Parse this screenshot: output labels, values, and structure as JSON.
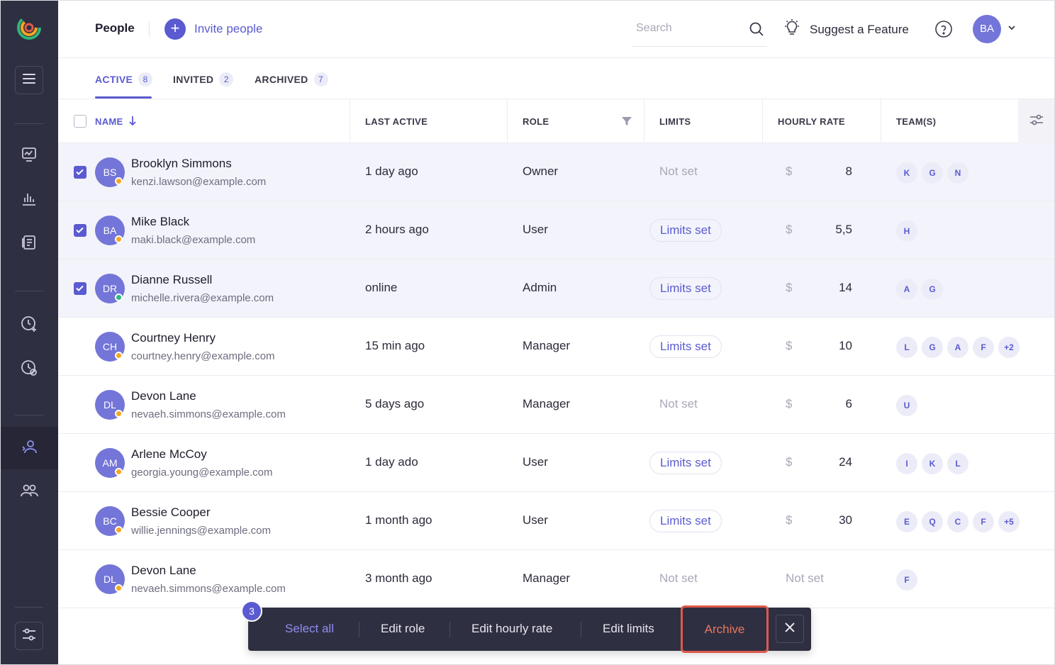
{
  "header": {
    "title": "People",
    "invite_label": "Invite people",
    "search_placeholder": "Search",
    "suggest_label": "Suggest a Feature",
    "user_initials": "BA"
  },
  "tabs": [
    {
      "label": "ACTIVE",
      "count": "8",
      "active": true
    },
    {
      "label": "INVITED",
      "count": "2",
      "active": false
    },
    {
      "label": "ARCHIVED",
      "count": "7",
      "active": false
    }
  ],
  "columns": {
    "name": "NAME",
    "last_active": "LAST ACTIVE",
    "role": "ROLE",
    "limits": "LIMITS",
    "hourly_rate": "HOURLY RATE",
    "teams": "TEAM(S)"
  },
  "rows": [
    {
      "initials": "BS",
      "name": "Brooklyn Simmons",
      "email": "kenzi.lawson@example.com",
      "status": "away",
      "last_active": "1 day ago",
      "role": "Owner",
      "limits": "Not set",
      "limits_set": false,
      "currency": "$",
      "rate": "8",
      "teams": [
        "K",
        "G",
        "N"
      ],
      "selected": true
    },
    {
      "initials": "BA",
      "name": "Mike Black",
      "email": "maki.black@example.com",
      "status": "away",
      "last_active": "2 hours ago",
      "role": "User",
      "limits": "Limits set",
      "limits_set": true,
      "currency": "$",
      "rate": "5,5",
      "teams": [
        "H"
      ],
      "selected": true
    },
    {
      "initials": "DR",
      "name": "Dianne Russell",
      "email": "michelle.rivera@example.com",
      "status": "online",
      "last_active": "online",
      "role": "Admin",
      "limits": "Limits set",
      "limits_set": true,
      "currency": "$",
      "rate": "14",
      "teams": [
        "A",
        "G"
      ],
      "selected": true
    },
    {
      "initials": "CH",
      "name": "Courtney Henry",
      "email": "courtney.henry@example.com",
      "status": "away",
      "last_active": "15 min ago",
      "role": "Manager",
      "limits": "Limits set",
      "limits_set": true,
      "currency": "$",
      "rate": "10",
      "teams": [
        "L",
        "G",
        "A",
        "F",
        "+2"
      ],
      "selected": false
    },
    {
      "initials": "DL",
      "name": "Devon Lane",
      "email": "nevaeh.simmons@example.com",
      "status": "away",
      "last_active": "5 days ago",
      "role": "Manager",
      "limits": "Not set",
      "limits_set": false,
      "currency": "$",
      "rate": "6",
      "teams": [
        "U"
      ],
      "selected": false
    },
    {
      "initials": "AM",
      "name": "Arlene McCoy",
      "email": "georgia.young@example.com",
      "status": "away",
      "last_active": "1 day ado",
      "role": "User",
      "limits": "Limits set",
      "limits_set": true,
      "currency": "$",
      "rate": "24",
      "teams": [
        "I",
        "K",
        "L"
      ],
      "selected": false
    },
    {
      "initials": "BC",
      "name": "Bessie Cooper",
      "email": "willie.jennings@example.com",
      "status": "away",
      "last_active": "1 month ago",
      "role": "User",
      "limits": "Limits set",
      "limits_set": true,
      "currency": "$",
      "rate": "30",
      "teams": [
        "E",
        "Q",
        "C",
        "F",
        "+5"
      ],
      "selected": false
    },
    {
      "initials": "DL",
      "name": "Devon Lane",
      "email": "nevaeh.simmons@example.com",
      "status": "away",
      "last_active": "3 month ago",
      "role": "Manager",
      "limits": "Not set",
      "limits_set": false,
      "currency": "",
      "rate": "Not set",
      "teams": [
        "F"
      ],
      "selected": false
    }
  ],
  "action_bar": {
    "selected_count": "3",
    "select_all": "Select all",
    "edit_role": "Edit role",
    "edit_hourly_rate": "Edit hourly rate",
    "edit_limits": "Edit limits",
    "archive": "Archive"
  },
  "colors": {
    "accent": "#5a5bd0",
    "sidebar": "#2f2f42",
    "highlight": "#e05a4a",
    "status_away": "#f5a623",
    "status_online": "#2eb67d"
  }
}
